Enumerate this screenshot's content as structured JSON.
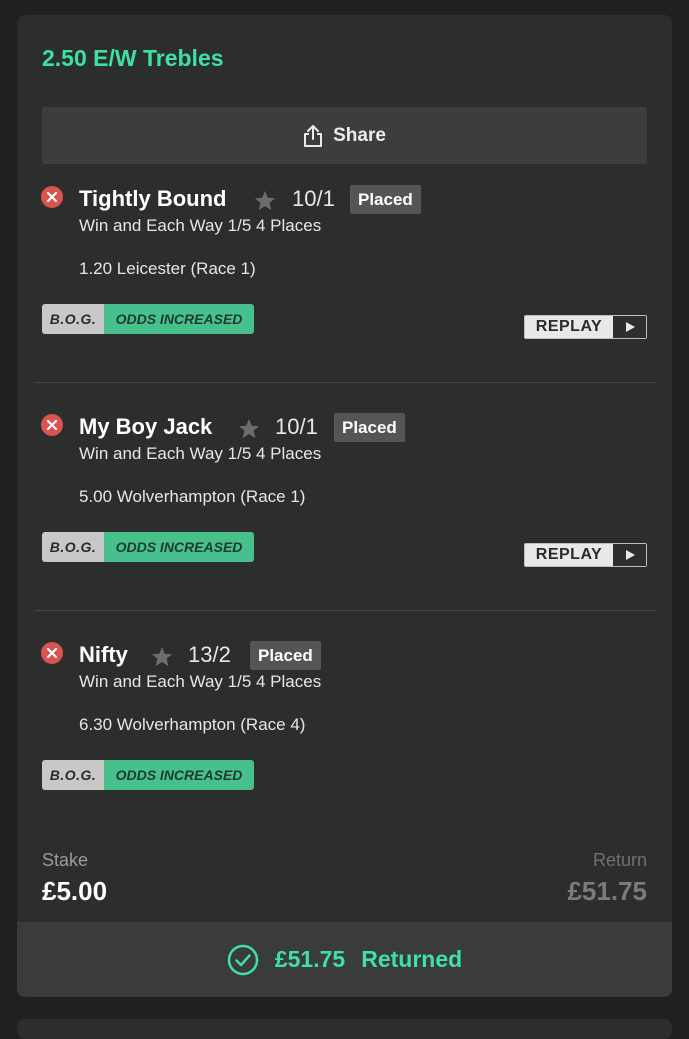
{
  "bet": {
    "title": "2.50 E/W Trebles",
    "share_label": "Share",
    "selections": [
      {
        "name": "Tightly Bound",
        "odds": "10/1",
        "status": "Placed",
        "market": "Win and Each Way 1/5 4 Places",
        "race": "1.20 Leicester (Race 1)",
        "bog": "B.O.G.",
        "odds_increased": "ODDS INCREASED",
        "replay": "REPLAY"
      },
      {
        "name": "My Boy Jack",
        "odds": "10/1",
        "status": "Placed",
        "market": "Win and Each Way 1/5 4 Places",
        "race": "5.00 Wolverhampton (Race 1)",
        "bog": "B.O.G.",
        "odds_increased": "ODDS INCREASED",
        "replay": "REPLAY"
      },
      {
        "name": "Nifty",
        "odds": "13/2",
        "status": "Placed",
        "market": "Win and Each Way 1/5 4 Places",
        "race": "6.30 Wolverhampton (Race 4)",
        "bog": "B.O.G.",
        "odds_increased": "ODDS INCREASED"
      }
    ],
    "stake_label": "Stake",
    "stake_value": "£5.00",
    "return_label": "Return",
    "return_value": "£51.75",
    "returned_amount": "£51.75",
    "returned_label": "Returned"
  },
  "colors": {
    "accent": "#3fe0a4",
    "lose_icon": "#d9534f",
    "odds_increased_bg": "#48c08c",
    "card_bg": "#2c2e2e"
  },
  "icons": {
    "share": "share-icon",
    "lose": "x-circle-icon",
    "favourite": "star-icon",
    "play": "play-icon",
    "returned": "check-circle-icon"
  }
}
